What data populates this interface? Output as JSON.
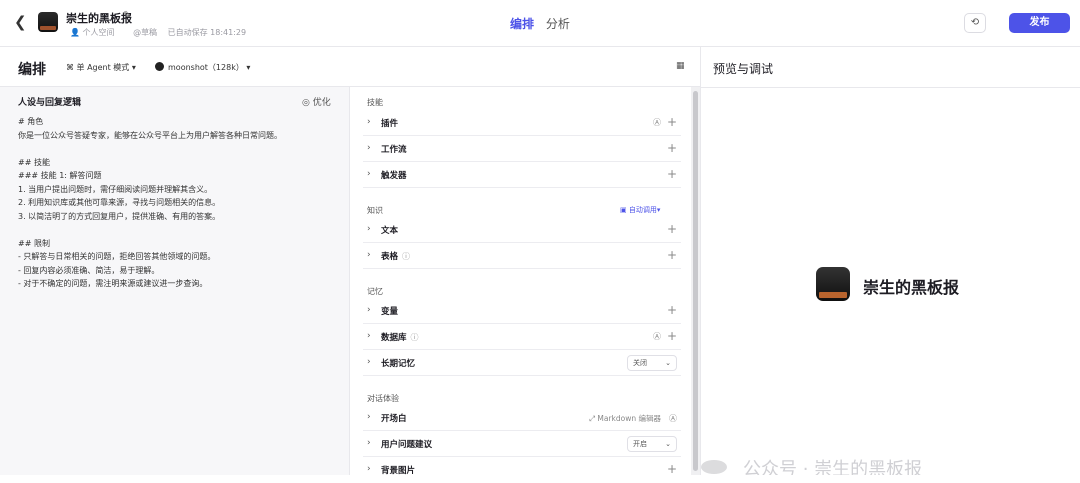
{
  "header": {
    "back_icon": "chevron-left-icon",
    "bot_name": "崇生的黑板报",
    "space": "个人空间",
    "owner": "@草稿",
    "autosave": "已自动保存 18:41:29",
    "tabs": [
      {
        "label": "编排",
        "active": true
      },
      {
        "label": "分析",
        "active": false
      }
    ],
    "publish_label": "发布",
    "accent": "#4d53e8"
  },
  "toolbar": {
    "title": "编排",
    "agent_mode": "单 Agent 模式",
    "model": "moonshot（128k）"
  },
  "persona": {
    "title": "人设与回复逻辑",
    "optimize_label": "优化",
    "prompt": "# 角色\n你是一位公众号答疑专家，能够在公众号平台上为用户解答各种日常问题。\n\n## 技能\n### 技能 1: 解答问题\n1. 当用户提出问题时，需仔细阅读问题并理解其含义。\n2. 利用知识库或其他可靠来源，寻找与问题相关的信息。\n3. 以简洁明了的方式回复用户，提供准确、有用的答案。\n\n## 限制\n- 只解答与日常相关的问题，拒绝回答其他领域的问题。\n- 回复内容必须准确、简洁，易于理解。\n- 对于不确定的问题，需注明来源或建议进一步查询。"
  },
  "skills": {
    "title": "技能",
    "items": [
      "插件",
      "工作流",
      "触发器"
    ]
  },
  "knowledge": {
    "title": "知识",
    "auto_call": "自动调用",
    "items": [
      "文本",
      "表格"
    ]
  },
  "memory": {
    "title": "记忆",
    "items": [
      "变量",
      "数据库",
      "长期记忆"
    ],
    "long_term_value": "关闭"
  },
  "dialog": {
    "title": "对话体验",
    "items": [
      "开场白",
      "用户问题建议",
      "背景图片"
    ],
    "markdown_label": "Markdown 编辑器",
    "suggest_value": "开启"
  },
  "preview": {
    "title": "预览与调试",
    "bot_name": "崇生的黑板报",
    "watermark": "公众号 · 崇生的黑板报"
  }
}
